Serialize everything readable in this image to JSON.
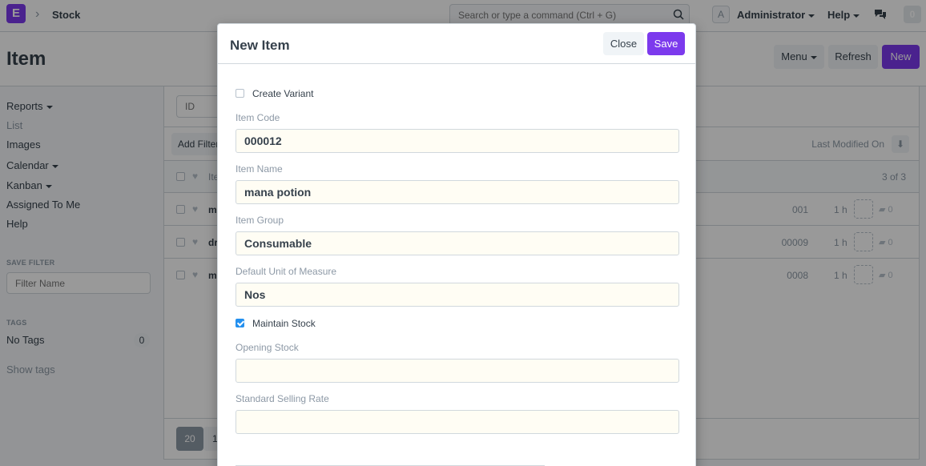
{
  "navbar": {
    "logo_letter": "E",
    "module": "Stock",
    "search_placeholder": "Search or type a command (Ctrl + G)",
    "avatar_letter": "A",
    "user": "Administrator",
    "help": "Help",
    "notifications": "0"
  },
  "page": {
    "title": "Item",
    "menu_label": "Menu",
    "refresh_label": "Refresh",
    "new_label": "New"
  },
  "sidebar": {
    "reports": "Reports",
    "list": "List",
    "images": "Images",
    "calendar": "Calendar",
    "kanban": "Kanban",
    "assigned_to_me": "Assigned To Me",
    "help": "Help",
    "save_filter_heading": "SAVE FILTER",
    "filter_placeholder": "Filter Name",
    "tags_heading": "TAGS",
    "no_tags": "No Tags",
    "tag_count": "0",
    "show_tags": "Show tags"
  },
  "list": {
    "id_placeholder": "ID",
    "add_filter": "Add Filter",
    "sort_label": "Last Modified On",
    "header_title": "Ite",
    "count": "3 of 3",
    "rows": [
      {
        "title": "m",
        "code": "001",
        "time": "1 h",
        "comments": "0"
      },
      {
        "title": "dr",
        "code": "00009",
        "time": "1 h",
        "comments": "0"
      },
      {
        "title": "m",
        "code": "0008",
        "time": "1 h",
        "comments": "0"
      }
    ],
    "page_size_1": "20",
    "page_size_2": "1"
  },
  "modal": {
    "title": "New Item",
    "close_label": "Close",
    "save_label": "Save",
    "create_variant_label": "Create Variant",
    "create_variant_checked": false,
    "item_code_label": "Item Code",
    "item_code_value": "000012",
    "item_name_label": "Item Name",
    "item_name_value": "mana potion",
    "item_group_label": "Item Group",
    "item_group_value": "Consumable",
    "uom_label": "Default Unit of Measure",
    "uom_value": "Nos",
    "maintain_stock_label": "Maintain Stock",
    "maintain_stock_checked": true,
    "opening_stock_label": "Opening Stock",
    "opening_stock_value": "",
    "selling_rate_label": "Standard Selling Rate",
    "selling_rate_value": ""
  },
  "colors": {
    "primary": "#7c3aed",
    "checkbox_checked": "#2490ef",
    "input_background": "#fffdf4"
  }
}
